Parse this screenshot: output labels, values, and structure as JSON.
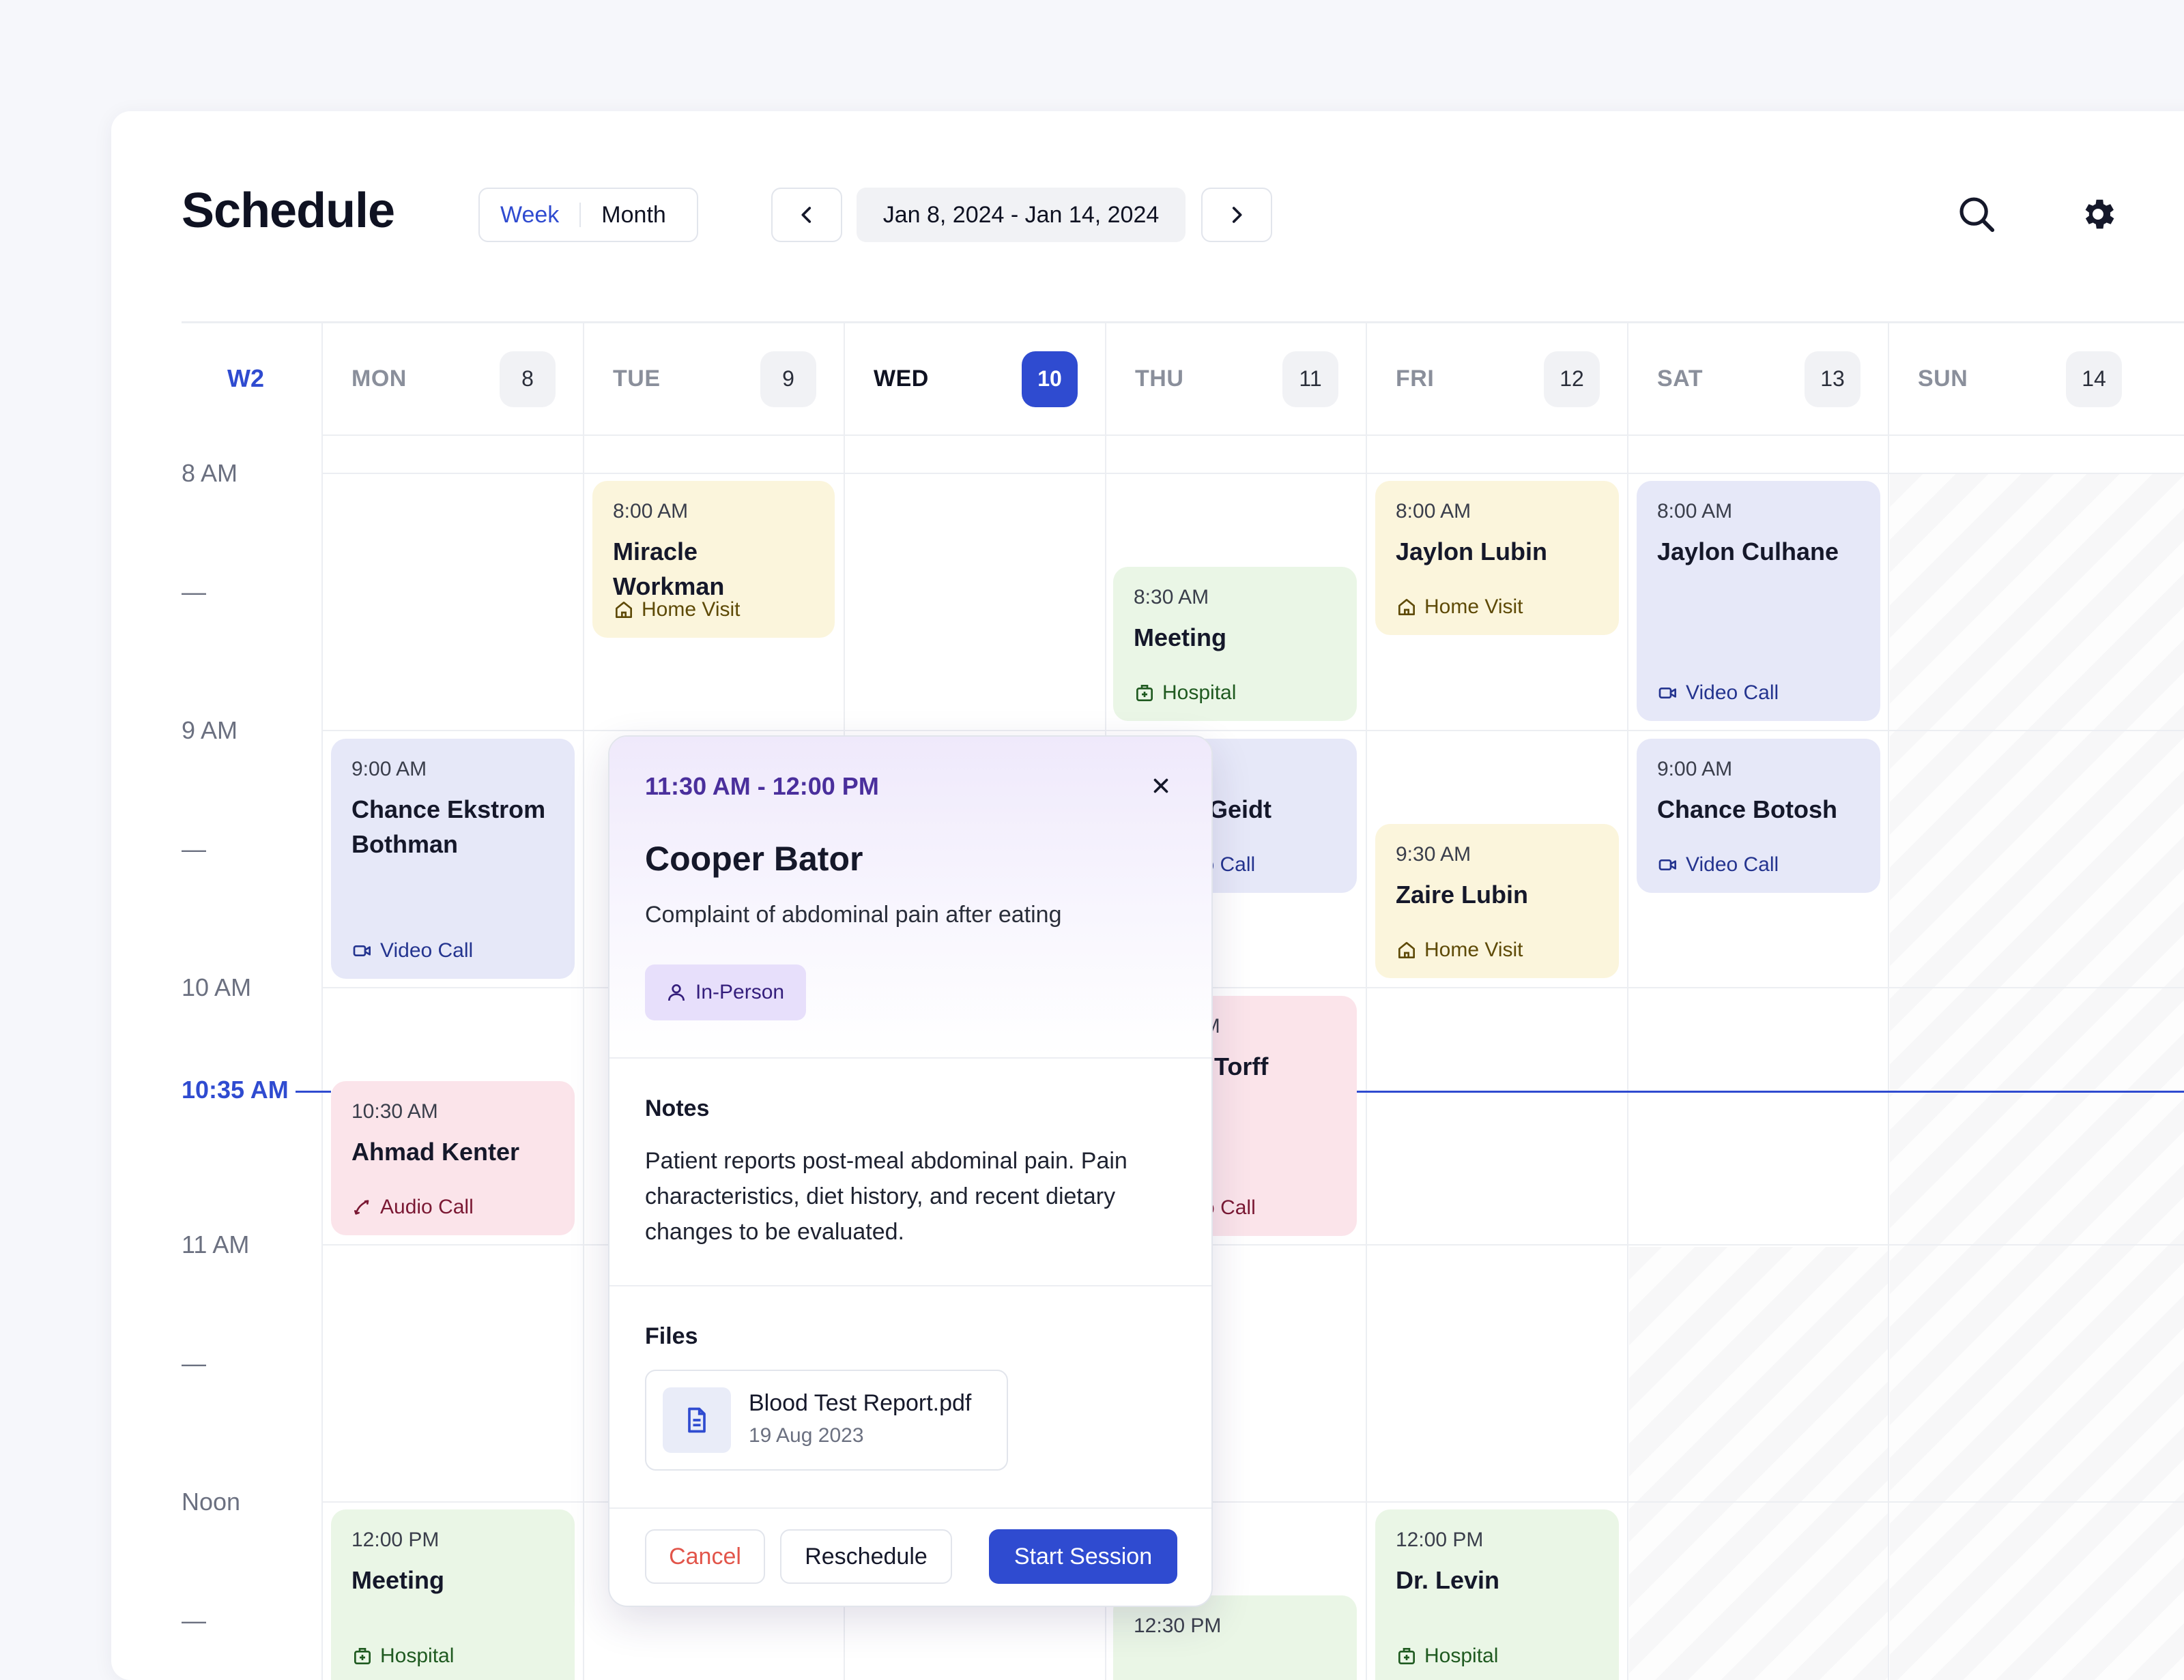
{
  "header": {
    "title": "Schedule",
    "view_week": "Week",
    "view_month": "Month",
    "date_range": "Jan 8, 2024 - Jan 14, 2024"
  },
  "week_label": "W2",
  "days": [
    {
      "name": "MON",
      "num": "8"
    },
    {
      "name": "TUE",
      "num": "9"
    },
    {
      "name": "WED",
      "num": "10"
    },
    {
      "name": "THU",
      "num": "11"
    },
    {
      "name": "FRI",
      "num": "12"
    },
    {
      "name": "SAT",
      "num": "13"
    },
    {
      "name": "SUN",
      "num": "14"
    }
  ],
  "time_labels": [
    "8 AM",
    "9 AM",
    "10 AM",
    "11 AM",
    "Noon"
  ],
  "half_marker": "—",
  "current_time": "10:35 AM",
  "events": {
    "tue_1": {
      "time": "8:00 AM",
      "name": "Miracle Workman",
      "type": "Home Visit"
    },
    "thu_1": {
      "time": "8:30 AM",
      "name": "Meeting",
      "type": "Hospital"
    },
    "fri_1": {
      "time": "8:00 AM",
      "name": "Jaylon Lubin",
      "type": "Home Visit"
    },
    "sat_1": {
      "time": "8:00 AM",
      "name": "Jaylon Culhane",
      "type": "Video Call"
    },
    "mon_1": {
      "time": "9:00 AM",
      "name": "Chance Ekstrom Bothman",
      "type": "Video Call"
    },
    "thu_2": {
      "time": "9:00 AM",
      "name": "Kadin Geidt",
      "type": "Video Call"
    },
    "fri_2": {
      "time": "9:30 AM",
      "name": "Zaire Lubin",
      "type": "Home Visit"
    },
    "sat_2": {
      "time": "9:00 AM",
      "name": "Chance Botosh",
      "type": "Video Call"
    },
    "mon_2": {
      "time": "10:30 AM",
      "name": "Ahmad Kenter",
      "type": "Audio Call"
    },
    "thu_3": {
      "time": "10:30 AM",
      "name": "Paityn Torff",
      "type": "Audio Call"
    },
    "mon_3": {
      "time": "12:00 PM",
      "name": "Meeting",
      "type": "Hospital"
    },
    "thu_4": {
      "time": "12:30 PM",
      "name": "",
      "type": ""
    },
    "fri_3": {
      "time": "12:00 PM",
      "name": "Dr. Levin",
      "type": "Hospital"
    }
  },
  "popover": {
    "time": "11:30 AM - 12:00 PM",
    "name": "Cooper Bator",
    "description": "Complaint of abdominal pain after eating",
    "tag": "In-Person",
    "notes_label": "Notes",
    "notes": "Patient reports post-meal abdominal pain. Pain characteristics, diet history, and recent dietary changes to be evaluated.",
    "files_label": "Files",
    "file_name": "Blood Test Report.pdf",
    "file_date": "19 Aug 2023",
    "cancel": "Cancel",
    "reschedule": "Reschedule",
    "start": "Start Session"
  },
  "colors": {
    "accent": "#2F4BD0",
    "home_visit": "#FBF5DC",
    "video_call": "#E6E8F8",
    "hospital": "#EAF6E6",
    "audio_call": "#FBE4EA",
    "popover_tint": "#EFE9FB",
    "cancel_text": "#E2554A"
  },
  "icons": {
    "search": "search-icon",
    "settings": "gear-icon",
    "prev": "chevron-left-icon",
    "next": "chevron-right-icon",
    "home_visit": "home-icon",
    "video_call": "video-icon",
    "hospital": "hospital-icon",
    "audio_call": "phone-icon",
    "in_person": "user-icon",
    "file": "document-icon",
    "close": "close-icon"
  }
}
